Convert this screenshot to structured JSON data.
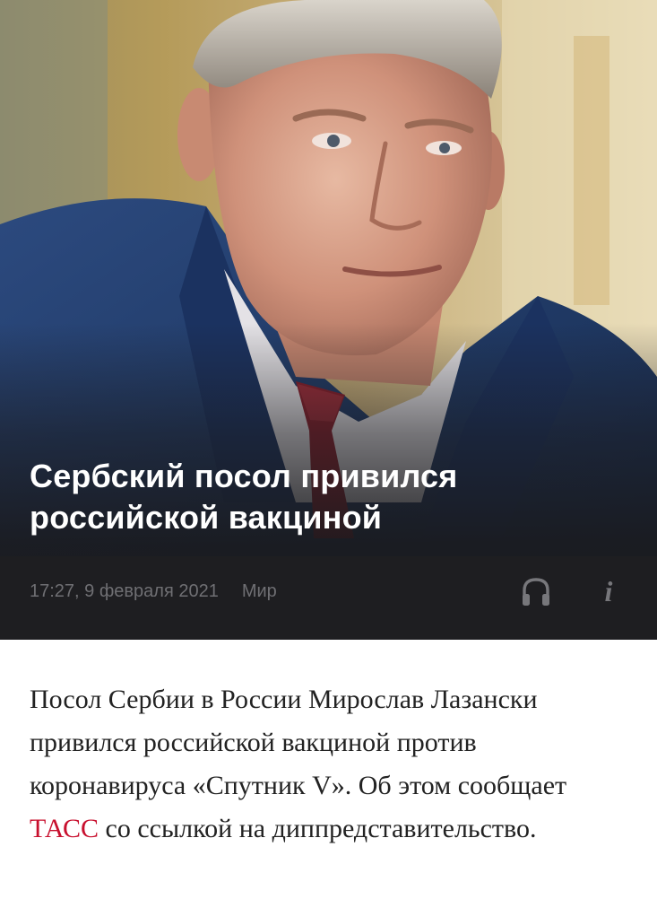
{
  "article": {
    "headline": "Сербский посол привился российской вакциной",
    "time": "17:27, 9 февраля 2021",
    "rubric": "Мир",
    "icons": {
      "audio": "headphones-icon",
      "info": "info-icon"
    },
    "info_glyph": "i",
    "body": {
      "before_link": "Посол Сербии в России Мирослав Лазански привился российской вакциной против коронавируса «Спутник V». Об этом сообщает ",
      "link_text": "ТАСС",
      "after_link": " со ссылкой на диппредставительство."
    }
  },
  "colors": {
    "link": "#c8102e",
    "body_text": "#222222",
    "meta_text": "#6f6f73",
    "headline_text": "#ffffff"
  }
}
